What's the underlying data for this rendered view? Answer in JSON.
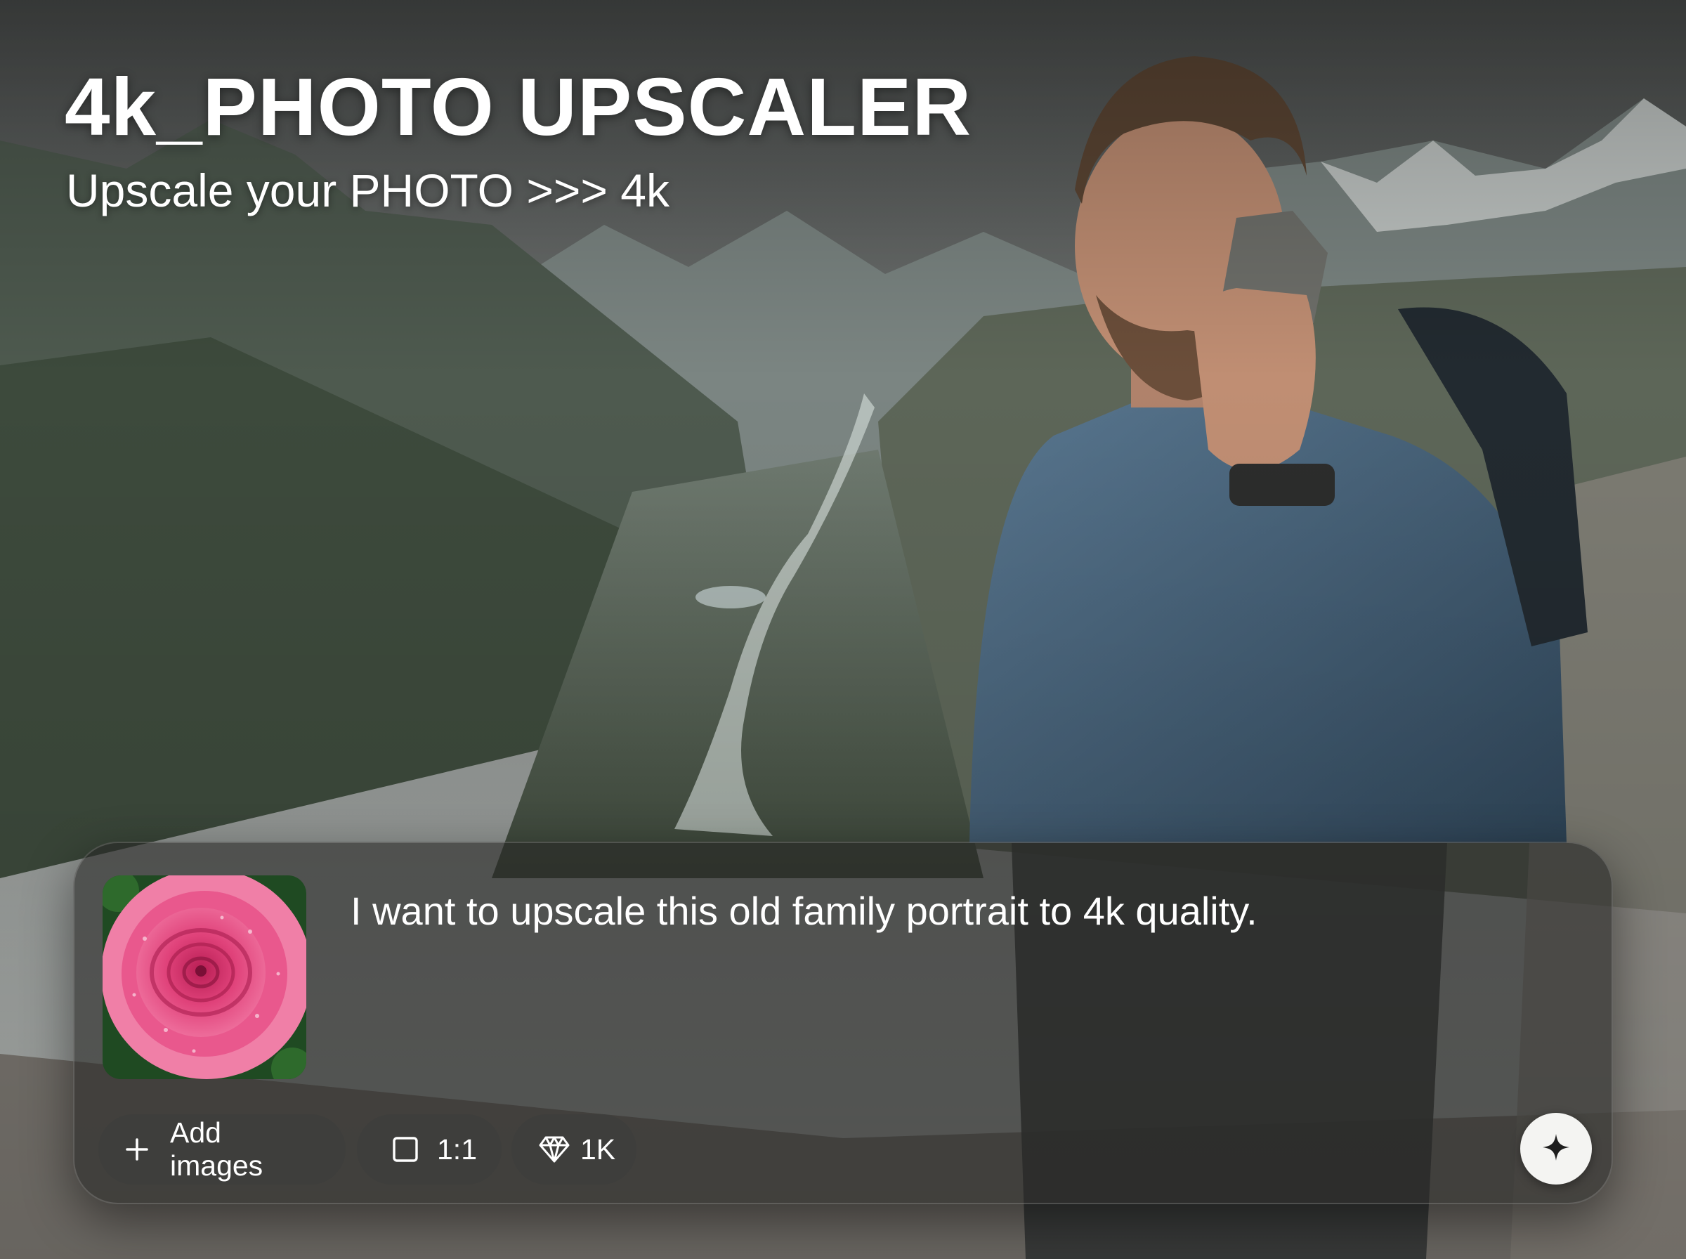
{
  "header": {
    "title": "4k_PHOTO UPSCALER",
    "subtitle": "Upscale your PHOTO >>> 4k"
  },
  "composer": {
    "prompt_text": "I want to upscale this old family portrait to 4k quality.",
    "attachment_icon": "pink-rose-photo",
    "toolbar": {
      "add_images_label": "Add images",
      "add_images_icon": "plus-icon",
      "aspect_ratio_value": "1:1",
      "aspect_ratio_icon": "square-icon",
      "resolution_value": "1K",
      "resolution_icon": "diamond-icon"
    },
    "send_icon": "sparkle-icon"
  },
  "colors": {
    "text": "#ffffff",
    "panel": "#262725",
    "pill": "#3e3e3c",
    "send_button": "#f4f4f2",
    "rose": "#e0427a"
  }
}
